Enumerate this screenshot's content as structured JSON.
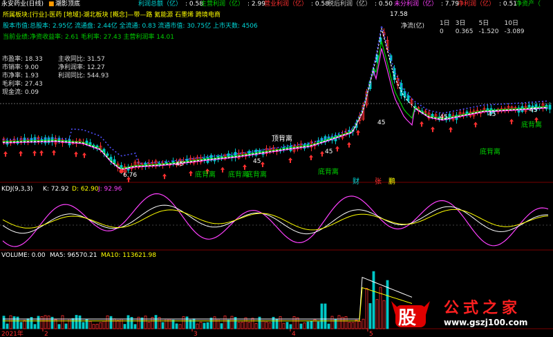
{
  "topbar": {
    "stock_name": "永安药业(日线)",
    "indicator": "潮影顶底",
    "items": [
      {
        "label": "利润总额（亿）",
        "value": ": 0.58",
        "color": "#00d8d8"
      },
      {
        "label": "主营利润（亿）",
        "value": ": 2.99",
        "color": "#00d000"
      },
      {
        "label": "营业利润（亿）",
        "value": ": 0.58",
        "color": "#ff3030"
      },
      {
        "label": "税后利润（亿）",
        "value": ": 0.50",
        "color": "#c8c8c8"
      },
      {
        "label": "未分利润（亿）",
        "value": ": 7.79",
        "color": "#ff40ff"
      },
      {
        "label": "净利润（亿）",
        "value": ": 0.51",
        "color": "#ff3030"
      },
      {
        "label": "净资产（",
        "value": "",
        "color": "#00d000"
      }
    ]
  },
  "info": {
    "line1_prefix": "所属板块",
    "line1": ":[行业]-医药 [地域]-湖北板块 [概念]—带—路 氦能源 石墨烯 跨境电商",
    "line2_prefix": "股本市值",
    "line2": ":总股本: 2.95亿 流通盘: 2.44亿 全流通: 0.83 流通市值: 30.75亿 上市天数: 4506",
    "line3_prefix": "当前业绩",
    "line3": ":净资收益率: 2.61 毛利率: 27.43 主营利润率 14.01"
  },
  "stats_left": [
    {
      "label": "市盈率",
      "value": ": 18.33"
    },
    {
      "label": "市销率",
      "value": ": 9.00"
    },
    {
      "label": "市净率",
      "value": ": 1.93"
    },
    {
      "label": "毛利率",
      "value": ": 27.43"
    },
    {
      "label": "现金流",
      "value": ": 0.09"
    }
  ],
  "stats_right": [
    {
      "label": "主收同比",
      "value": ": 31.57"
    },
    {
      "label": "净利润率",
      "value": ": 12.27"
    },
    {
      "label": "利润同比",
      "value": ": 544.93"
    }
  ],
  "flow": {
    "title": "净流(亿)",
    "headers": [
      "1日",
      "3日",
      "5日",
      "10日"
    ],
    "values": [
      "0",
      "0.365",
      "-1.520",
      "-3.089"
    ]
  },
  "price_labels": {
    "high": "17.58",
    "low": "6.76",
    "mid1": "45",
    "mid2": "45",
    "mid3": "45",
    "mid4": "45",
    "mid5": "45",
    "mid6": "45",
    "mid7": "45",
    "dot_label": "●5"
  },
  "annotations": {
    "top_div": "顶背离",
    "bottoms": [
      "底背离",
      "底背离",
      "底背离",
      "底背离",
      "底背离",
      "底背离"
    ],
    "tags": [
      "财",
      "张",
      "鹏"
    ]
  },
  "kdj": {
    "title": "KDJ(9,3,3)",
    "k": "K: 72.92",
    "d": "D: 62.90",
    "j": "J: 92.96"
  },
  "volume": {
    "title": "VOLUME: 0.00",
    "ma5": "MA5: 96570.21",
    "ma10": "MA10: 113621.98"
  },
  "xaxis": {
    "labels": [
      "2021年",
      "2",
      "3",
      "4",
      "5"
    ]
  },
  "watermark": {
    "glyph": "股",
    "text": "公式之家",
    "url": "www.gszj100.com"
  },
  "colors": {
    "up": "#ff3030",
    "down": "#00c8c8",
    "green": "#00d000",
    "magenta": "#ff40ff",
    "yellow": "#ffff00"
  }
}
